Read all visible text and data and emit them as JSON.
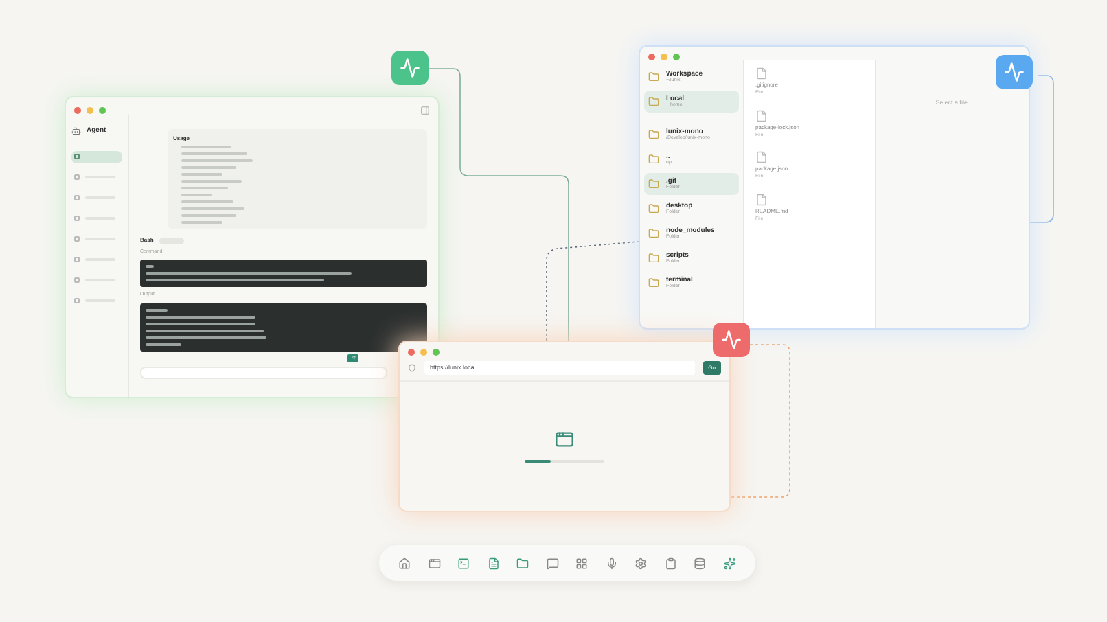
{
  "badges": [
    {
      "color": "#4cc38a"
    },
    {
      "color": "#5aa8f0"
    },
    {
      "color": "#ee6b6b"
    }
  ],
  "agent_window": {
    "title": "Agent",
    "sidebar": {
      "items": [
        {
          "selected": true
        },
        {
          "selected": false
        },
        {
          "selected": false
        },
        {
          "selected": false
        },
        {
          "selected": false
        },
        {
          "selected": false
        },
        {
          "selected": false
        },
        {
          "selected": false
        }
      ]
    },
    "usage_label": "Usage",
    "bash_label": "Bash",
    "command_label": "Command",
    "output_label": "Output"
  },
  "files_window": {
    "folders": [
      {
        "name": "Workspace",
        "sub": "~/lunix",
        "selected": false
      },
      {
        "name": "Local",
        "sub": "~ home",
        "selected": true
      },
      {
        "name": "lunix-mono",
        "sub": "/Develop/lunix-mono",
        "selected": false
      },
      {
        "name": "..",
        "sub": "up",
        "selected": false
      },
      {
        "name": ".git",
        "sub": "Folder",
        "selected": true
      },
      {
        "name": "desktop",
        "sub": "Folder",
        "selected": false
      },
      {
        "name": "node_modules",
        "sub": "Folder",
        "selected": false
      },
      {
        "name": "scripts",
        "sub": "Folder",
        "selected": false
      },
      {
        "name": "terminal",
        "sub": "Folder",
        "selected": false
      }
    ],
    "files": [
      {
        "name": ".gitignore",
        "sub": "File"
      },
      {
        "name": "package-lock.json",
        "sub": "File"
      },
      {
        "name": "package.json",
        "sub": "File"
      },
      {
        "name": "README.md",
        "sub": "File"
      }
    ],
    "preview_hint": "Select a file."
  },
  "browser_window": {
    "url": "https://lunix.local",
    "go": "Go",
    "loading": {
      "level": 0.33
    }
  },
  "dock": {
    "items": [
      {
        "kind": "home",
        "highlighted": false
      },
      {
        "kind": "window",
        "highlighted": false
      },
      {
        "kind": "terminal",
        "highlighted": true
      },
      {
        "kind": "file",
        "highlighted": true
      },
      {
        "kind": "folder",
        "highlighted": true
      },
      {
        "kind": "chat",
        "highlighted": false
      },
      {
        "kind": "grid",
        "highlighted": false
      },
      {
        "kind": "mic",
        "highlighted": false
      },
      {
        "kind": "settings",
        "highlighted": false
      },
      {
        "kind": "clipboard",
        "highlighted": false
      },
      {
        "kind": "database",
        "highlighted": false
      },
      {
        "kind": "sparkle",
        "highlighted": true
      }
    ]
  }
}
